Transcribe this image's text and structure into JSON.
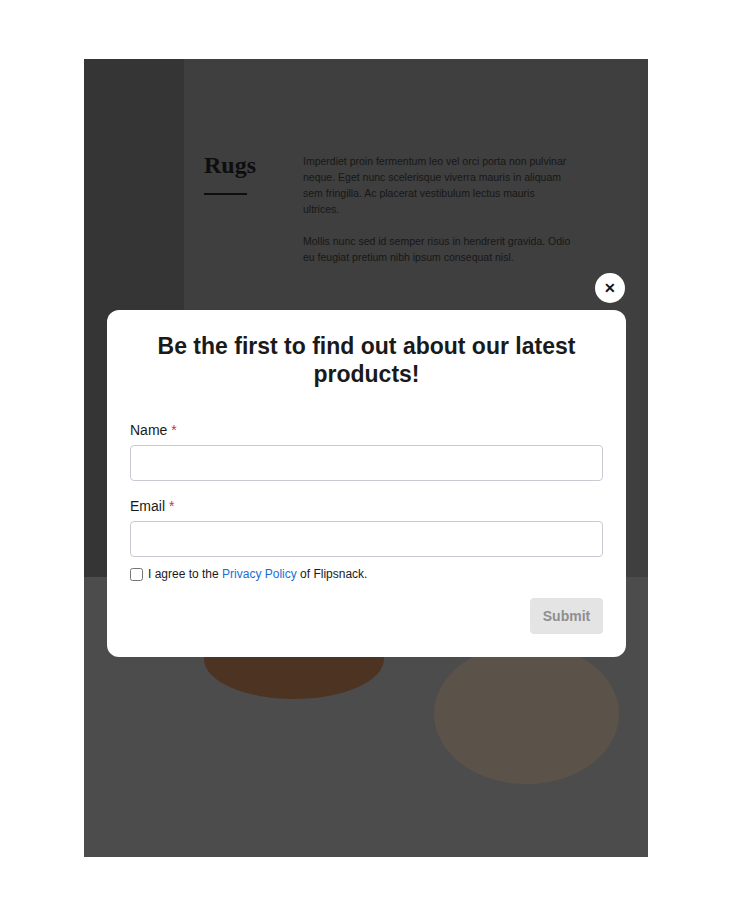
{
  "page": {
    "heading": "Rugs",
    "paragraphs": [
      "Imperdiet proin fermentum leo vel orci porta non pulvinar neque. Eget nunc scelerisque viverra mauris in aliquam sem fringilla. Ac placerat vestibulum lectus mauris ultrices.",
      "Mollis nunc sed id semper risus in hendrerit gravida. Odio eu feugiat pretium nibh ipsum consequat nisl."
    ]
  },
  "modal": {
    "close": "✕",
    "title": "Be the first to find out about our latest products!",
    "fields": [
      {
        "label": "Name",
        "required": true,
        "required_mark": "*",
        "value": ""
      },
      {
        "label": "Email",
        "required": true,
        "required_mark": "*",
        "value": ""
      }
    ],
    "consent": {
      "checked": false,
      "before": "I agree to the ",
      "link": "Privacy Policy",
      "after": " of Flipsnack."
    },
    "submit": {
      "label": "Submit",
      "disabled": true
    }
  }
}
